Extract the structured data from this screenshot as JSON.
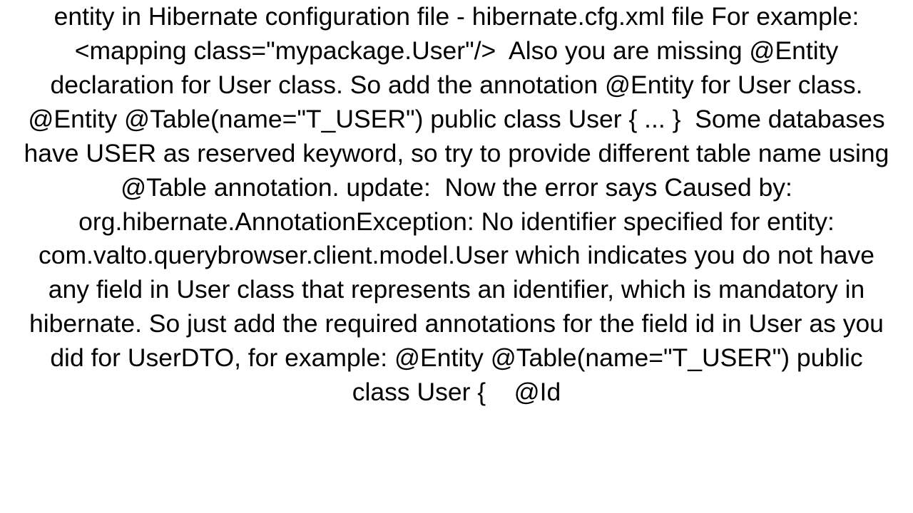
{
  "document": {
    "body_text": "entity in Hibernate configuration file - hibernate.cfg.xml file For example: <mapping class=\"mypackage.User\"/>  Also you are missing @Entity declaration for User class. So add the annotation @Entity for User class. @Entity @Table(name=\"T_USER\") public class User { ... }  Some databases have USER as reserved keyword, so try to provide different table name using @Table annotation. update:  Now the error says Caused by: org.hibernate.AnnotationException: No identifier specified for entity: com.valto.querybrowser.client.model.User which indicates you do not have any field in User class that represents an identifier, which is mandatory in hibernate. So just add the required annotations for the field id in User as you did for UserDTO, for example: @Entity @Table(name=\"T_USER\") public class User {    @Id"
  }
}
